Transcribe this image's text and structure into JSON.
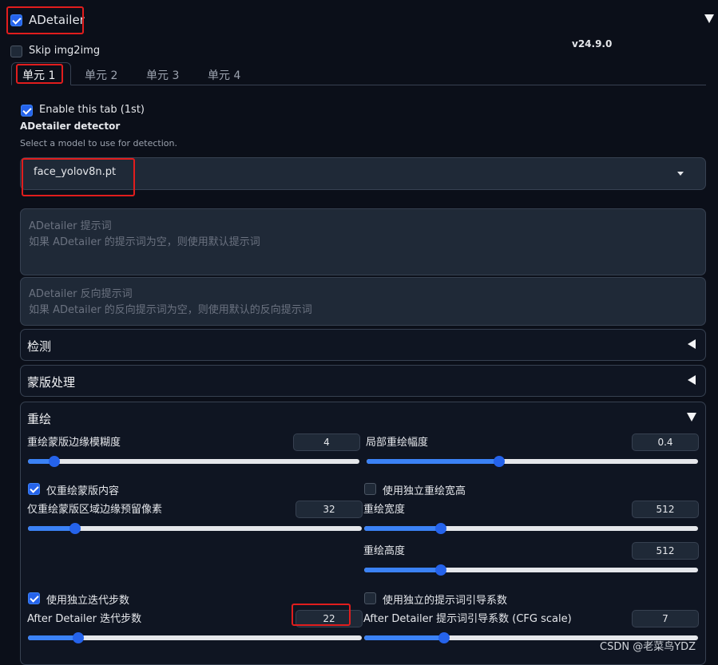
{
  "header": {
    "title": "ADetailer",
    "version": "v24.9.0"
  },
  "skip_img2img": "Skip img2img",
  "tabs": [
    "单元 1",
    "单元 2",
    "单元 3",
    "单元 4"
  ],
  "enable_tab": "Enable this tab (1st)",
  "detector": {
    "label": "ADetailer detector",
    "info": "Select a model to use for detection.",
    "value": "face_yolov8n.pt"
  },
  "prompt": {
    "title": "ADetailer 提示词",
    "placeholder": "如果 ADetailer 的提示词为空，则使用默认提示词"
  },
  "neg_prompt": {
    "title": "ADetailer 反向提示词",
    "placeholder": "如果 ADetailer 的反向提示词为空，则使用默认的反向提示词"
  },
  "sections": {
    "detection": "检测",
    "mask": "蒙版处理",
    "inpaint": "重绘"
  },
  "inpaint": {
    "mask_blur": {
      "label": "重绘蒙版边缘模糊度",
      "value": "4",
      "fraction": 0.08
    },
    "denoise": {
      "label": "局部重绘幅度",
      "value": "0.4",
      "fraction": 0.4
    },
    "only_masked": "仅重绘蒙版内容",
    "padding": {
      "label": "仅重绘蒙版区域边缘预留像素",
      "value": "32",
      "fraction": 0.14
    },
    "use_wh": "使用独立重绘宽高",
    "width": {
      "label": "重绘宽度",
      "value": "512",
      "fraction": 0.23
    },
    "height": {
      "label": "重绘高度",
      "value": "512",
      "fraction": 0.23
    },
    "use_steps": "使用独立迭代步数",
    "steps": {
      "label": "After Detailer 迭代步数",
      "value": "22",
      "fraction": 0.15
    },
    "use_cfg": "使用独立的提示词引导系数",
    "cfg": {
      "label": "After Detailer 提示词引导系数 (CFG scale)",
      "value": "7",
      "fraction": 0.24
    }
  },
  "watermark": "CSDN @老菜鸟YDZ"
}
